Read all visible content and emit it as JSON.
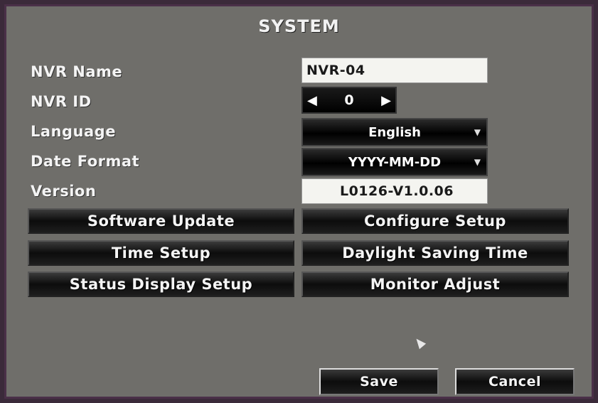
{
  "title": "SYSTEM",
  "fields": {
    "nvr_name_label": "NVR Name",
    "nvr_name_value": "NVR-04",
    "nvr_id_label": "NVR ID",
    "nvr_id_value": "0",
    "language_label": "Language",
    "language_value": "English",
    "date_format_label": "Date Format",
    "date_format_value": "YYYY-MM-DD",
    "version_label": "Version",
    "version_value": "L0126-V1.0.06"
  },
  "buttons": {
    "software_update": "Software Update",
    "configure_setup": "Configure Setup",
    "time_setup": "Time Setup",
    "daylight_saving_time": "Daylight Saving Time",
    "status_display_setup": "Status Display Setup",
    "monitor_adjust": "Monitor Adjust",
    "save": "Save",
    "cancel": "Cancel"
  },
  "icons": {
    "spinner_left": "left-arrow-icon",
    "spinner_right": "right-arrow-icon",
    "dropdown": "chevron-down-icon",
    "cursor": "mouse-pointer-icon"
  }
}
